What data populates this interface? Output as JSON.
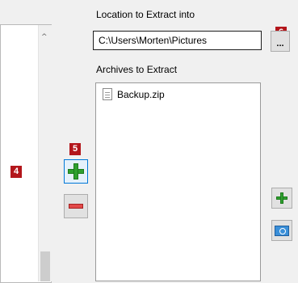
{
  "labels": {
    "location": "Location to Extract into",
    "archives": "Archives to Extract"
  },
  "location_input": {
    "value": "C:\\Users\\Morten\\Pictures"
  },
  "browse_button": {
    "label": "..."
  },
  "archives": [
    {
      "name": "Backup.zip"
    }
  ],
  "badges": {
    "b4": "4",
    "b5": "5",
    "b6": "6"
  },
  "left_list": {
    "scroll_up_glyph": "^"
  },
  "colors": {
    "badge": "#b3161b",
    "add": "#2fa02f",
    "remove": "#e24a4a",
    "focus": "#0078d7"
  }
}
